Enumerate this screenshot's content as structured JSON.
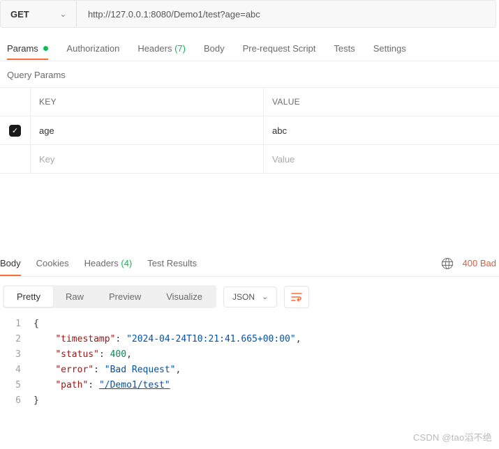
{
  "request": {
    "method": "GET",
    "url": "http://127.0.0.1:8080/Demo1/test?age=abc"
  },
  "tabs": {
    "params": "Params",
    "authorization": "Authorization",
    "headers": "Headers",
    "headers_count": "(7)",
    "body": "Body",
    "prerequest": "Pre-request Script",
    "tests": "Tests",
    "settings": "Settings"
  },
  "query": {
    "heading": "Query Params",
    "cols": {
      "key": "KEY",
      "value": "VALUE"
    },
    "rows": [
      {
        "checked": true,
        "key": "age",
        "value": "abc"
      }
    ],
    "placeholder_key": "Key",
    "placeholder_value": "Value"
  },
  "resp_tabs": {
    "body": "Body",
    "cookies": "Cookies",
    "headers": "Headers",
    "headers_count": "(4)",
    "test_results": "Test Results"
  },
  "response": {
    "status_text": "400 Bad"
  },
  "view": {
    "pretty": "Pretty",
    "raw": "Raw",
    "preview": "Preview",
    "visualize": "Visualize",
    "format": "JSON"
  },
  "json": {
    "l1": "{",
    "k_timestamp": "\"timestamp\"",
    "v_timestamp": "\"2024-04-24T10:21:41.665+00:00\"",
    "k_status": "\"status\"",
    "v_status": "400",
    "k_error": "\"error\"",
    "v_error": "\"Bad Request\"",
    "k_path": "\"path\"",
    "v_path": "\"/Demo1/test\"",
    "l6": "}"
  },
  "watermark": "CSDN @tao滔不绝"
}
